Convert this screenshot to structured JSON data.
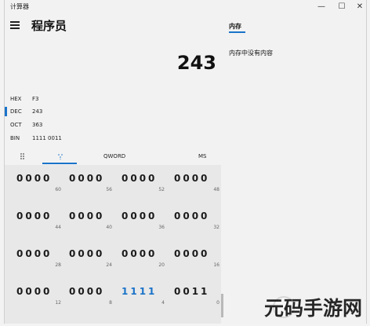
{
  "app": {
    "title": "计算器",
    "mode": "程序员"
  },
  "window_controls": {
    "minimize": "—",
    "maximize": "☐",
    "close": "✕"
  },
  "display": {
    "value": "243"
  },
  "radix": [
    {
      "label": "HEX",
      "value": "F3"
    },
    {
      "label": "DEC",
      "value": "243"
    },
    {
      "label": "OCT",
      "value": "363"
    },
    {
      "label": "BIN",
      "value": "1111 0011"
    }
  ],
  "toolbar": {
    "qword": "QWORD",
    "ms": "MS",
    "keypad_icon": "keypad-icon",
    "bit_icon": "bit-toggle-icon"
  },
  "memory": {
    "tab": "内存",
    "empty_text": "内存中没有内容"
  },
  "bits": [
    {
      "bits": "0000",
      "pos": "60"
    },
    {
      "bits": "0000",
      "pos": "56"
    },
    {
      "bits": "0000",
      "pos": "52"
    },
    {
      "bits": "0000",
      "pos": "48"
    },
    {
      "bits": "0000",
      "pos": "44"
    },
    {
      "bits": "0000",
      "pos": "40"
    },
    {
      "bits": "0000",
      "pos": "36"
    },
    {
      "bits": "0000",
      "pos": "32"
    },
    {
      "bits": "0000",
      "pos": "28"
    },
    {
      "bits": "0000",
      "pos": "24"
    },
    {
      "bits": "0000",
      "pos": "20"
    },
    {
      "bits": "0000",
      "pos": "16"
    },
    {
      "bits": "0000",
      "pos": "12"
    },
    {
      "bits": "0000",
      "pos": "8"
    },
    {
      "bits": "1111",
      "pos": "4"
    },
    {
      "bits": "0011",
      "pos": "0"
    }
  ],
  "watermark": "元码手游网",
  "colors": {
    "accent": "#1a73c9",
    "marker": "#c83232"
  }
}
